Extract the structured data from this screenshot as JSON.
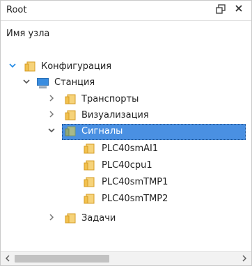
{
  "window": {
    "title": "Root",
    "pin_icon": "❐",
    "close_icon": "✕"
  },
  "tree_header": "Имя узла",
  "tree": {
    "configuration": {
      "label": "Конфигурация",
      "arrow": "⌵"
    },
    "station": {
      "label": "Станция",
      "arrow": "⌵"
    },
    "transports": {
      "label": "Транспорты",
      "arrow": "›"
    },
    "visualization": {
      "label": "Визуализация",
      "arrow": "›"
    },
    "signals": {
      "label": "Сигналы",
      "arrow": "⌵"
    },
    "plc1": {
      "label": "PLC40smAI1"
    },
    "plc2": {
      "label": "PLC40cpu1"
    },
    "plc3": {
      "label": "PLC40smTMP1"
    },
    "plc4": {
      "label": "PLC40smTMP2"
    },
    "tasks": {
      "label": "Задачи",
      "arrow": "›"
    }
  },
  "scrollbar": {
    "left_arrow": "‹",
    "right_arrow": "›"
  },
  "colors": {
    "selection": "#4a90e2",
    "folder_yellow": "#f2c14e",
    "folder_dark": "#d69d25",
    "folder_green": "#7a9a6a",
    "monitor": "#3a8de0",
    "root_arrow": "#1e88e5"
  }
}
